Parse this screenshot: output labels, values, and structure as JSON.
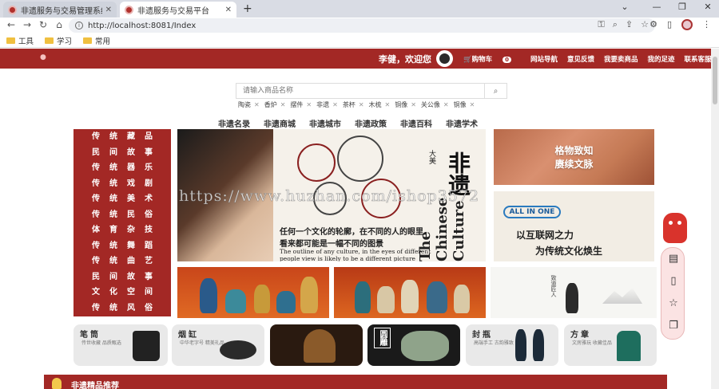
{
  "browser": {
    "tabs": [
      {
        "title": "非遗服务与交易管理系统",
        "active": false
      },
      {
        "title": "非遗服务与交易平台",
        "active": true
      }
    ],
    "url": "http://localhost:8081/Index",
    "bookmarks": [
      "工具",
      "学习",
      "常用"
    ]
  },
  "topnav": {
    "welcome": "李健，欢迎您",
    "cart_label": "购物车",
    "cart_count": "0",
    "links": [
      "网站导航",
      "意见反馈",
      "我要卖商品",
      "我的足迹",
      "联系客服"
    ]
  },
  "search": {
    "placeholder": "请输入商品名称",
    "hot_words": [
      "陶瓷",
      "香炉",
      "摆件",
      "非遗",
      "茶杯",
      "木梳",
      "铜像",
      "关公像",
      "铜像"
    ]
  },
  "category_nav": [
    "非遗名录",
    "非遗商城",
    "非遗城市",
    "非遗政策",
    "非遗百科",
    "非遗学术"
  ],
  "left_menu": [
    "传统藏品",
    "民间故事",
    "传统器乐",
    "传统戏剧",
    "传统美术",
    "传统民俗",
    "体育杂技",
    "传统舞蹈",
    "传统曲艺",
    "民间故事",
    "文化空间",
    "传统风俗"
  ],
  "banner": {
    "big_text": "非遗",
    "vertical_small": "大美",
    "english_vertical": "The Chinese Culture",
    "line1": "任何一个文化的轮廓，在不同的人的眼里",
    "line2": "看来都可能是一幅不同的图景",
    "line3": "The outline of any culture, in the eyes of different people view is likely to be a different picture"
  },
  "right_banners": {
    "top_line1": "格物致知",
    "top_line2": "赓续文脉",
    "all_in_one": "ALL IN ONE",
    "slogan1": "以互联网之力",
    "slogan2": "为传统文化焕生"
  },
  "product_panels": {
    "p3_text": "致道匠人"
  },
  "cards": [
    {
      "title": "笔筒",
      "sub": "传世收藏 品质甄选"
    },
    {
      "title": "烟缸",
      "sub": "中华老字号 精美礼品"
    },
    {
      "title": "",
      "sub": ""
    },
    {
      "title": "圆雕",
      "sub": ""
    },
    {
      "title": "封瓶",
      "sub": "高端手工 古韵雅致"
    },
    {
      "title": "方章",
      "sub": "文房雅玩 收藏佳品"
    }
  ],
  "recommend": {
    "title": "非遗精品推荐"
  },
  "watermark": "https://www.huzhan.com/ishop3572",
  "colors": {
    "brand_red": "#a32825",
    "tab_bar": "#d9dce4"
  }
}
